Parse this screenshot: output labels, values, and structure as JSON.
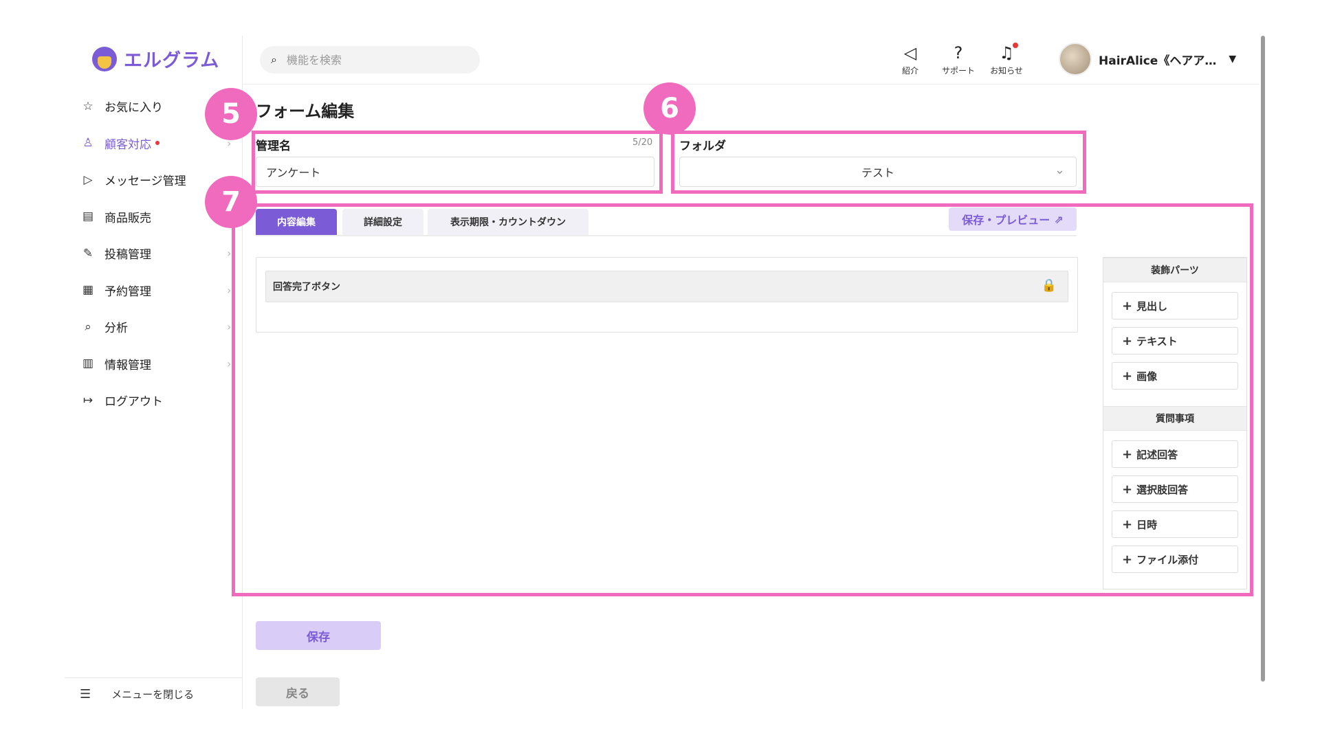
{
  "app": {
    "logo_text": "エルグラム"
  },
  "sidebar": {
    "items": [
      {
        "icon": "☆",
        "label": "お気に入り"
      },
      {
        "icon": "♙",
        "label": "顧客対応"
      },
      {
        "icon": "▷",
        "label": "メッセージ管理"
      },
      {
        "icon": "▤",
        "label": "商品販売"
      },
      {
        "icon": "✎",
        "label": "投稿管理"
      },
      {
        "icon": "▦",
        "label": "予約管理"
      },
      {
        "icon": "⌕",
        "label": "分析"
      },
      {
        "icon": "▥",
        "label": "情報管理"
      },
      {
        "icon": "↦",
        "label": "ログアウト"
      }
    ],
    "close_label": "メニューを閉じる",
    "close_icon": "☰",
    "chevron": "›"
  },
  "header": {
    "search_placeholder": "機能を検索",
    "search_icon": "⌕",
    "icons": [
      {
        "glyph": "◁",
        "caption": "紹介"
      },
      {
        "glyph": "?",
        "caption": "サポート"
      },
      {
        "glyph": "♫",
        "caption": "お知らせ"
      }
    ],
    "user_name": "HairAlice《ヘアア…",
    "user_caret": "▼"
  },
  "page": {
    "title": "フォーム編集",
    "name_label": "管理名",
    "name_counter": "5/20",
    "name_value": "アンケート",
    "folder_label": "フォルダ",
    "folder_value": "テスト",
    "folder_chevron": "⌄",
    "tabs": [
      "内容編集",
      "詳細設定",
      "表示期限・カウントダウン"
    ],
    "preview_label": "保存・プレビュー",
    "preview_icon": "⇗",
    "content_row_label": "回答完了ボタン",
    "lock_icon": "🔒",
    "save_label": "保存",
    "back_label": "戻る"
  },
  "parts": {
    "decoration_heading": "装飾パーツ",
    "decoration_items": [
      "見出し",
      "テキスト",
      "画像"
    ],
    "question_heading": "質問事項",
    "question_items": [
      "記述回答",
      "選択肢回答",
      "日時",
      "ファイル添付"
    ],
    "plus": "+"
  },
  "annotations": {
    "badges": [
      "5",
      "6",
      "7"
    ],
    "color": "#f06bbd"
  },
  "colors": {
    "accent": "#7b5cd6",
    "accent_light": "#e3dbf8",
    "highlight": "#f06bbd"
  }
}
